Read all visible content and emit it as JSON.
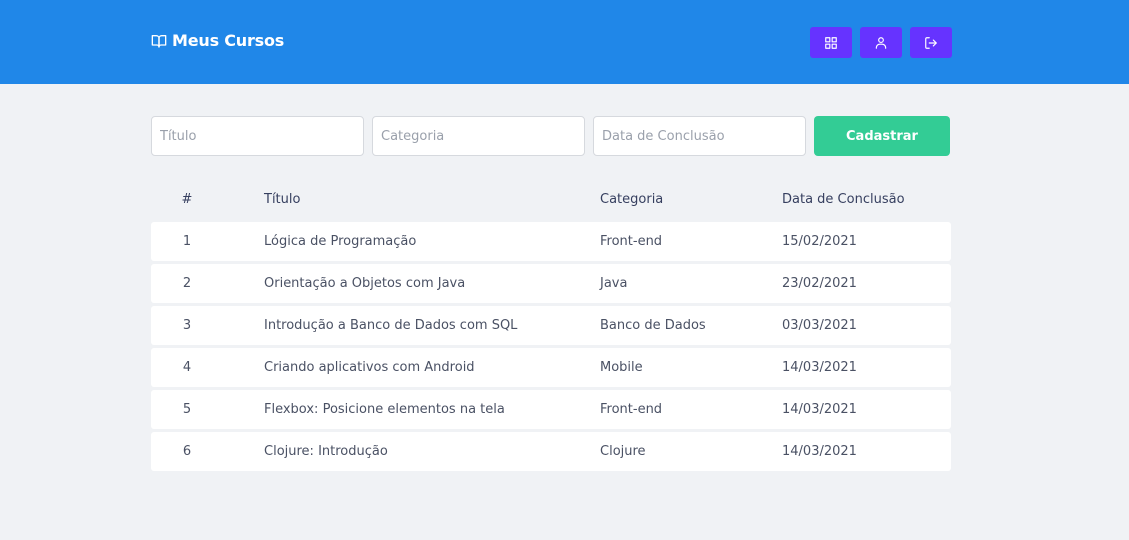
{
  "header": {
    "title": "Meus Cursos",
    "icons": [
      "book-open-icon",
      "grid-icon",
      "user-icon",
      "logout-icon"
    ]
  },
  "form": {
    "title_placeholder": "Título",
    "category_placeholder": "Categoria",
    "date_placeholder": "Data de Conclusão",
    "submit_label": "Cadastrar"
  },
  "table": {
    "headers": {
      "num": "#",
      "title": "Título",
      "category": "Categoria",
      "date": "Data de Conclusão"
    },
    "rows": [
      {
        "num": "1",
        "title": "Lógica de Programação",
        "category": "Front-end",
        "date": "15/02/2021"
      },
      {
        "num": "2",
        "title": "Orientação a Objetos com Java",
        "category": "Java",
        "date": "23/02/2021"
      },
      {
        "num": "3",
        "title": "Introdução a Banco de Dados com SQL",
        "category": "Banco de Dados",
        "date": "03/03/2021"
      },
      {
        "num": "4",
        "title": "Criando aplicativos com Android",
        "category": "Mobile",
        "date": "14/03/2021"
      },
      {
        "num": "5",
        "title": "Flexbox: Posicione elementos na tela",
        "category": "Front-end",
        "date": "14/03/2021"
      },
      {
        "num": "6",
        "title": "Clojure: Introdução",
        "category": "Clojure",
        "date": "14/03/2021"
      }
    ]
  },
  "colors": {
    "header": "#2087e8",
    "icon_button": "#6633ff",
    "submit": "#33cc95",
    "background": "#f0f2f5"
  }
}
